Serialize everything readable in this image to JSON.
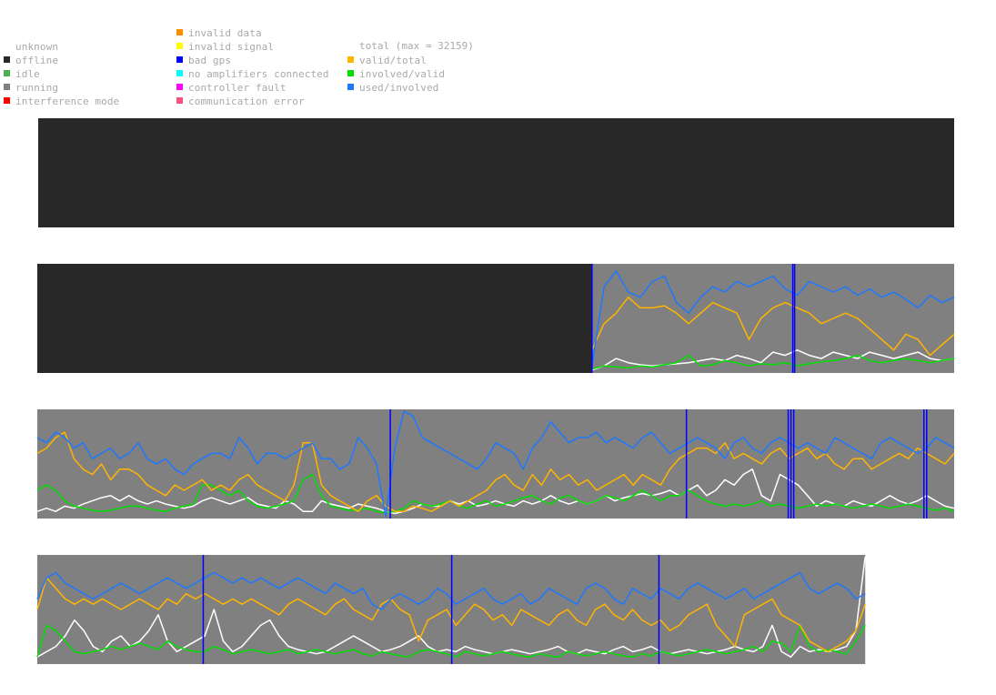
{
  "legend": {
    "status_items": [
      {
        "label": "unknown",
        "color": "#ffffff"
      },
      {
        "label": "offline",
        "color": "#282828"
      },
      {
        "label": "idle",
        "color": "#4caf50"
      },
      {
        "label": "running",
        "color": "#808080"
      },
      {
        "label": "interference mode",
        "color": "#ff0000"
      }
    ],
    "error_items": [
      {
        "label": "invalid data",
        "color": "#ff8c00"
      },
      {
        "label": "invalid signal",
        "color": "#ffff00"
      },
      {
        "label": "bad gps",
        "color": "#0000ff"
      },
      {
        "label": "no amplifiers connected",
        "color": "#00ffff"
      },
      {
        "label": "controller fault",
        "color": "#ff00ff"
      },
      {
        "label": "communication error",
        "color": "#ff4f7f"
      }
    ],
    "series_title": "total (max = 32159)",
    "series_items": [
      {
        "label": "valid/total",
        "color": "#ffb400"
      },
      {
        "label": "involved/valid",
        "color": "#00e000"
      },
      {
        "label": "used/involved",
        "color": "#1e78ff"
      }
    ]
  },
  "chart_data": {
    "type": "line",
    "title": "",
    "description_of_rows": "four stacked timeline strips, each covering a consecutive time range",
    "y_range": [
      0,
      1
    ],
    "series": [
      {
        "name": "total (max = 32159)",
        "color": "#ffffff"
      },
      {
        "name": "valid/total",
        "color": "#ffb400"
      },
      {
        "name": "involved/valid",
        "color": "#00e000"
      },
      {
        "name": "used/involved",
        "color": "#1e78ff"
      }
    ],
    "rows": [
      {
        "status_segments": [
          {
            "from": 0.0,
            "to": 1.0,
            "status": "offline"
          }
        ],
        "bad_gps_marks": [],
        "data_start": null,
        "data_end": null,
        "values": {
          "total": [],
          "valid_total": [],
          "involved_valid": [],
          "used_involved": []
        }
      },
      {
        "status_segments": [
          {
            "from": 0.0,
            "to": 0.605,
            "status": "offline"
          },
          {
            "from": 0.605,
            "to": 1.0,
            "status": "running"
          }
        ],
        "bad_gps_marks": [
          0.605,
          0.824,
          0.826
        ],
        "data_start": 0.605,
        "data_end": 1.0,
        "values": {
          "used_involved": [
            0.05,
            0.8,
            0.95,
            0.75,
            0.7,
            0.85,
            0.9,
            0.65,
            0.55,
            0.7,
            0.8,
            0.75,
            0.85,
            0.8,
            0.85,
            0.9,
            0.78,
            0.72,
            0.85,
            0.8,
            0.75,
            0.8,
            0.72,
            0.78,
            0.7,
            0.75,
            0.68,
            0.6,
            0.72,
            0.65,
            0.7
          ],
          "valid_total": [
            0.2,
            0.45,
            0.55,
            0.7,
            0.6,
            0.6,
            0.62,
            0.55,
            0.45,
            0.55,
            0.65,
            0.6,
            0.55,
            0.3,
            0.5,
            0.6,
            0.65,
            0.6,
            0.55,
            0.45,
            0.5,
            0.55,
            0.5,
            0.4,
            0.3,
            0.2,
            0.35,
            0.3,
            0.15,
            0.25,
            0.35
          ],
          "involved_valid": [
            0.02,
            0.05,
            0.04,
            0.03,
            0.05,
            0.04,
            0.06,
            0.08,
            0.15,
            0.05,
            0.06,
            0.1,
            0.08,
            0.05,
            0.07,
            0.06,
            0.08,
            0.05,
            0.07,
            0.09,
            0.1,
            0.12,
            0.15,
            0.1,
            0.08,
            0.1,
            0.12,
            0.1,
            0.08,
            0.1,
            0.12
          ],
          "total": [
            0.01,
            0.05,
            0.12,
            0.08,
            0.06,
            0.05,
            0.06,
            0.07,
            0.08,
            0.1,
            0.12,
            0.1,
            0.15,
            0.12,
            0.08,
            0.18,
            0.15,
            0.2,
            0.15,
            0.12,
            0.18,
            0.15,
            0.12,
            0.18,
            0.15,
            0.12,
            0.15,
            0.18,
            0.12,
            0.1,
            0.12
          ]
        }
      },
      {
        "status_segments": [
          {
            "from": 0.0,
            "to": 1.0,
            "status": "running"
          }
        ],
        "bad_gps_marks": [
          0.385,
          0.708,
          0.819,
          0.822,
          0.825,
          0.967,
          0.97
        ],
        "data_start": 0.0,
        "data_end": 1.0,
        "values": {
          "used_involved": [
            0.75,
            0.7,
            0.8,
            0.75,
            0.65,
            0.7,
            0.55,
            0.6,
            0.65,
            0.55,
            0.6,
            0.7,
            0.55,
            0.5,
            0.55,
            0.45,
            0.4,
            0.5,
            0.55,
            0.6,
            0.6,
            0.55,
            0.75,
            0.65,
            0.5,
            0.6,
            0.6,
            0.55,
            0.6,
            0.65,
            0.7,
            0.55,
            0.55,
            0.45,
            0.5,
            0.75,
            0.65,
            0.5,
            0.0,
            0.65,
            1.0,
            0.95,
            0.75,
            0.7,
            0.65,
            0.6,
            0.55,
            0.5,
            0.45,
            0.55,
            0.7,
            0.65,
            0.6,
            0.45,
            0.65,
            0.75,
            0.9,
            0.8,
            0.7,
            0.75,
            0.75,
            0.8,
            0.7,
            0.75,
            0.7,
            0.65,
            0.75,
            0.8,
            0.7,
            0.6,
            0.65,
            0.7,
            0.75,
            0.7,
            0.65,
            0.55,
            0.7,
            0.75,
            0.65,
            0.6,
            0.7,
            0.75,
            0.7,
            0.65,
            0.7,
            0.65,
            0.6,
            0.75,
            0.7,
            0.65,
            0.6,
            0.55,
            0.7,
            0.75,
            0.7,
            0.65,
            0.6,
            0.65,
            0.75,
            0.7,
            0.65
          ],
          "valid_total": [
            0.6,
            0.65,
            0.75,
            0.8,
            0.55,
            0.45,
            0.4,
            0.5,
            0.35,
            0.45,
            0.45,
            0.4,
            0.3,
            0.25,
            0.2,
            0.3,
            0.25,
            0.3,
            0.35,
            0.25,
            0.3,
            0.25,
            0.35,
            0.4,
            0.3,
            0.25,
            0.2,
            0.15,
            0.3,
            0.7,
            0.7,
            0.3,
            0.2,
            0.15,
            0.1,
            0.05,
            0.15,
            0.2,
            0.1,
            0.05,
            0.05,
            0.1,
            0.08,
            0.05,
            0.1,
            0.15,
            0.1,
            0.15,
            0.2,
            0.25,
            0.35,
            0.4,
            0.3,
            0.25,
            0.4,
            0.3,
            0.45,
            0.35,
            0.4,
            0.3,
            0.35,
            0.25,
            0.3,
            0.35,
            0.4,
            0.3,
            0.4,
            0.35,
            0.3,
            0.45,
            0.55,
            0.6,
            0.65,
            0.65,
            0.6,
            0.7,
            0.55,
            0.6,
            0.55,
            0.5,
            0.6,
            0.65,
            0.55,
            0.6,
            0.65,
            0.55,
            0.6,
            0.5,
            0.45,
            0.55,
            0.55,
            0.45,
            0.5,
            0.55,
            0.6,
            0.55,
            0.65,
            0.6,
            0.55,
            0.5,
            0.6
          ],
          "involved_valid": [
            0.25,
            0.3,
            0.25,
            0.15,
            0.1,
            0.08,
            0.06,
            0.05,
            0.06,
            0.08,
            0.1,
            0.1,
            0.08,
            0.06,
            0.05,
            0.08,
            0.1,
            0.12,
            0.3,
            0.3,
            0.25,
            0.2,
            0.25,
            0.15,
            0.1,
            0.08,
            0.1,
            0.12,
            0.15,
            0.35,
            0.4,
            0.2,
            0.1,
            0.08,
            0.06,
            0.06,
            0.08,
            0.05,
            0.04,
            0.05,
            0.08,
            0.15,
            0.12,
            0.1,
            0.12,
            0.15,
            0.1,
            0.08,
            0.12,
            0.15,
            0.1,
            0.12,
            0.15,
            0.18,
            0.2,
            0.15,
            0.12,
            0.18,
            0.2,
            0.15,
            0.12,
            0.15,
            0.2,
            0.18,
            0.15,
            0.2,
            0.25,
            0.2,
            0.15,
            0.2,
            0.2,
            0.25,
            0.2,
            0.15,
            0.12,
            0.1,
            0.12,
            0.1,
            0.12,
            0.15,
            0.1,
            0.12,
            0.1,
            0.08,
            0.1,
            0.12,
            0.1,
            0.12,
            0.1,
            0.08,
            0.1,
            0.12,
            0.1,
            0.08,
            0.1,
            0.12,
            0.1,
            0.08,
            0.06,
            0.08,
            0.05
          ],
          "total": [
            0.05,
            0.08,
            0.05,
            0.1,
            0.08,
            0.12,
            0.15,
            0.18,
            0.2,
            0.15,
            0.2,
            0.15,
            0.12,
            0.15,
            0.12,
            0.1,
            0.08,
            0.1,
            0.15,
            0.18,
            0.15,
            0.12,
            0.15,
            0.18,
            0.12,
            0.1,
            0.08,
            0.15,
            0.12,
            0.05,
            0.05,
            0.15,
            0.12,
            0.1,
            0.08,
            0.12,
            0.1,
            0.08,
            0.05,
            0.03,
            0.05,
            0.08,
            0.12,
            0.1,
            0.1,
            0.15,
            0.12,
            0.15,
            0.1,
            0.12,
            0.15,
            0.12,
            0.1,
            0.15,
            0.12,
            0.15,
            0.2,
            0.15,
            0.12,
            0.15,
            0.12,
            0.15,
            0.2,
            0.15,
            0.18,
            0.2,
            0.22,
            0.2,
            0.22,
            0.25,
            0.2,
            0.25,
            0.3,
            0.2,
            0.25,
            0.35,
            0.3,
            0.4,
            0.45,
            0.2,
            0.15,
            0.4,
            0.35,
            0.3,
            0.2,
            0.1,
            0.15,
            0.12,
            0.1,
            0.15,
            0.12,
            0.1,
            0.15,
            0.2,
            0.15,
            0.12,
            0.15,
            0.2,
            0.15,
            0.1,
            0.08
          ]
        }
      },
      {
        "status_segments": [
          {
            "from": 0.0,
            "to": 0.903,
            "status": "running"
          }
        ],
        "bad_gps_marks": [
          0.181,
          0.452,
          0.678
        ],
        "data_start": 0.0,
        "data_end": 0.903,
        "values": {
          "used_involved": [
            0.6,
            0.8,
            0.85,
            0.75,
            0.7,
            0.65,
            0.6,
            0.65,
            0.7,
            0.75,
            0.7,
            0.65,
            0.7,
            0.75,
            0.8,
            0.75,
            0.7,
            0.75,
            0.8,
            0.85,
            0.8,
            0.75,
            0.8,
            0.75,
            0.8,
            0.75,
            0.7,
            0.75,
            0.8,
            0.75,
            0.7,
            0.65,
            0.75,
            0.7,
            0.65,
            0.7,
            0.55,
            0.5,
            0.6,
            0.65,
            0.6,
            0.55,
            0.6,
            0.7,
            0.65,
            0.55,
            0.6,
            0.65,
            0.7,
            0.6,
            0.55,
            0.6,
            0.65,
            0.55,
            0.6,
            0.7,
            0.65,
            0.6,
            0.55,
            0.7,
            0.75,
            0.7,
            0.6,
            0.55,
            0.7,
            0.65,
            0.6,
            0.7,
            0.65,
            0.6,
            0.7,
            0.75,
            0.7,
            0.65,
            0.6,
            0.65,
            0.7,
            0.6,
            0.65,
            0.7,
            0.75,
            0.8,
            0.85,
            0.7,
            0.65,
            0.7,
            0.75,
            0.7,
            0.6,
            0.65
          ],
          "valid_total": [
            0.5,
            0.8,
            0.7,
            0.6,
            0.55,
            0.6,
            0.55,
            0.6,
            0.55,
            0.5,
            0.55,
            0.6,
            0.55,
            0.5,
            0.6,
            0.55,
            0.65,
            0.6,
            0.65,
            0.6,
            0.55,
            0.6,
            0.55,
            0.6,
            0.55,
            0.5,
            0.45,
            0.55,
            0.6,
            0.55,
            0.5,
            0.45,
            0.55,
            0.6,
            0.5,
            0.45,
            0.4,
            0.55,
            0.6,
            0.5,
            0.45,
            0.2,
            0.4,
            0.45,
            0.5,
            0.35,
            0.45,
            0.55,
            0.5,
            0.4,
            0.45,
            0.35,
            0.5,
            0.45,
            0.4,
            0.35,
            0.45,
            0.5,
            0.4,
            0.35,
            0.5,
            0.55,
            0.45,
            0.4,
            0.5,
            0.4,
            0.35,
            0.4,
            0.3,
            0.35,
            0.45,
            0.5,
            0.55,
            0.35,
            0.25,
            0.15,
            0.45,
            0.5,
            0.55,
            0.6,
            0.45,
            0.4,
            0.35,
            0.2,
            0.15,
            0.1,
            0.15,
            0.2,
            0.3,
            0.55
          ],
          "involved_valid": [
            0.05,
            0.35,
            0.3,
            0.2,
            0.1,
            0.08,
            0.1,
            0.12,
            0.15,
            0.12,
            0.15,
            0.18,
            0.15,
            0.12,
            0.2,
            0.15,
            0.12,
            0.1,
            0.1,
            0.15,
            0.12,
            0.08,
            0.1,
            0.12,
            0.1,
            0.08,
            0.1,
            0.12,
            0.08,
            0.1,
            0.12,
            0.1,
            0.08,
            0.1,
            0.12,
            0.08,
            0.06,
            0.1,
            0.08,
            0.06,
            0.05,
            0.1,
            0.12,
            0.1,
            0.08,
            0.05,
            0.1,
            0.08,
            0.06,
            0.08,
            0.1,
            0.08,
            0.06,
            0.05,
            0.08,
            0.06,
            0.05,
            0.1,
            0.08,
            0.06,
            0.08,
            0.1,
            0.08,
            0.06,
            0.05,
            0.08,
            0.06,
            0.1,
            0.08,
            0.06,
            0.08,
            0.1,
            0.12,
            0.1,
            0.08,
            0.1,
            0.12,
            0.15,
            0.1,
            0.2,
            0.18,
            0.1,
            0.35,
            0.15,
            0.1,
            0.12,
            0.1,
            0.08,
            0.2,
            0.35
          ],
          "total": [
            0.05,
            0.1,
            0.15,
            0.25,
            0.4,
            0.3,
            0.15,
            0.1,
            0.2,
            0.25,
            0.15,
            0.2,
            0.3,
            0.45,
            0.2,
            0.1,
            0.15,
            0.2,
            0.25,
            0.5,
            0.2,
            0.1,
            0.15,
            0.25,
            0.35,
            0.4,
            0.25,
            0.15,
            0.12,
            0.1,
            0.08,
            0.1,
            0.15,
            0.2,
            0.25,
            0.2,
            0.15,
            0.1,
            0.12,
            0.15,
            0.2,
            0.25,
            0.15,
            0.1,
            0.12,
            0.1,
            0.15,
            0.12,
            0.1,
            0.08,
            0.1,
            0.12,
            0.1,
            0.08,
            0.1,
            0.12,
            0.15,
            0.1,
            0.08,
            0.12,
            0.1,
            0.08,
            0.12,
            0.15,
            0.1,
            0.12,
            0.15,
            0.1,
            0.08,
            0.1,
            0.12,
            0.1,
            0.08,
            0.1,
            0.12,
            0.15,
            0.12,
            0.1,
            0.15,
            0.35,
            0.1,
            0.05,
            0.15,
            0.1,
            0.12,
            0.1,
            0.12,
            0.15,
            0.3,
            1.0
          ]
        }
      }
    ]
  }
}
